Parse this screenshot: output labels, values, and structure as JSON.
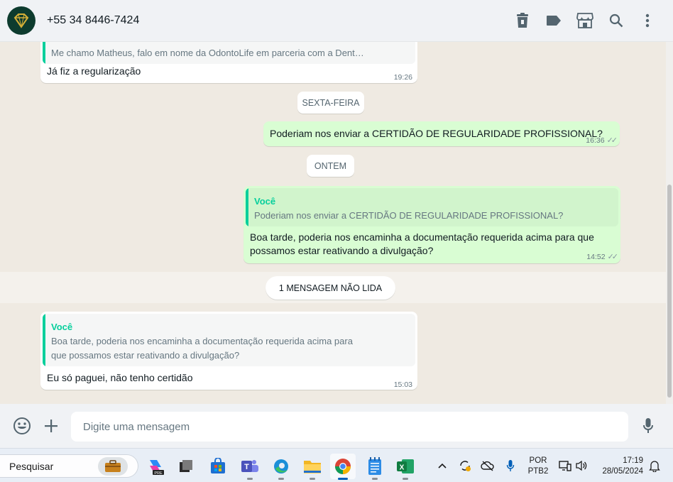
{
  "header": {
    "contact": "+55 34 8446-7424",
    "actions": [
      "trash-icon",
      "label-icon",
      "store-icon",
      "search-icon",
      "menu-icon"
    ]
  },
  "messages": {
    "m1": {
      "quote_text": "Me chamo Matheus, falo em nome da OdontoLife em parceria com a Dent…",
      "text": "Já fiz a regularização",
      "time": "19:26"
    },
    "date1": "SEXTA-FEIRA",
    "m2": {
      "text": "Poderiam nos enviar a CERTIDÃO DE REGULARIDADE PROFISSIONAL?",
      "time": "16:36"
    },
    "date2": "ONTEM",
    "m3": {
      "quote_author": "Você",
      "quote_text": "Poderiam nos enviar a CERTIDÃO DE REGULARIDADE PROFISSIONAL?",
      "text_line1": "Boa tarde, poderia nos encaminha a documentação requerida acima para que",
      "text_line2": "possamos estar reativando a divulgação?",
      "time": "14:52"
    },
    "unread": "1 MENSAGEM NÃO LIDA",
    "m4": {
      "quote_author": "Você",
      "quote_line1": "Boa tarde, poderia nos encaminha a documentação requerida acima para",
      "quote_line2": "que possamos estar reativando a divulgação?",
      "text": "Eu só paguei, não tenho certidão",
      "time": "15:03"
    }
  },
  "composer": {
    "placeholder": "Digite uma mensagem"
  },
  "taskbar": {
    "search_label": "Pesquisar",
    "lang_line1": "POR",
    "lang_line2": "PTB2",
    "time": "17:19",
    "date": "28/05/2024"
  },
  "colors": {
    "accent": "#06cf9c",
    "outgoing": "#d9fdd3",
    "incoming": "#ffffff",
    "header_bg": "#f0f2f5",
    "chat_bg": "#efeae2"
  }
}
